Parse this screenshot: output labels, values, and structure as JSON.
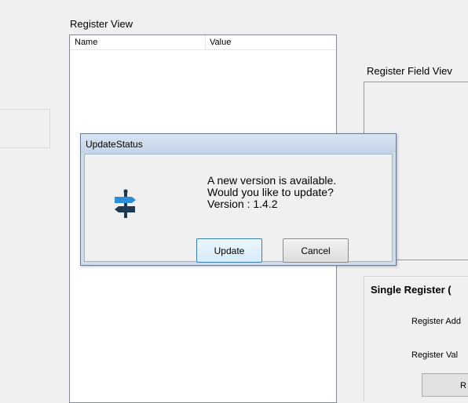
{
  "register_view": {
    "title": "Register View",
    "columns": [
      "Name",
      "Value"
    ]
  },
  "field_view": {
    "title": "Register Field Viev"
  },
  "single_register": {
    "title": "Single Register (",
    "address_label": "Register Add",
    "value_label": "Register Val",
    "button_label": "R"
  },
  "dialog": {
    "title": "UpdateStatus",
    "message_lines": [
      "A new version is available.",
      "Would you like to update?",
      "Version : 1.4.2"
    ],
    "update_label": "Update",
    "cancel_label": "Cancel",
    "icon": "signpost-icon"
  },
  "colors": {
    "accent": "#2a8fd6",
    "icon_dark": "#1e3a52",
    "dialog_frame": "#cfdbe9"
  }
}
